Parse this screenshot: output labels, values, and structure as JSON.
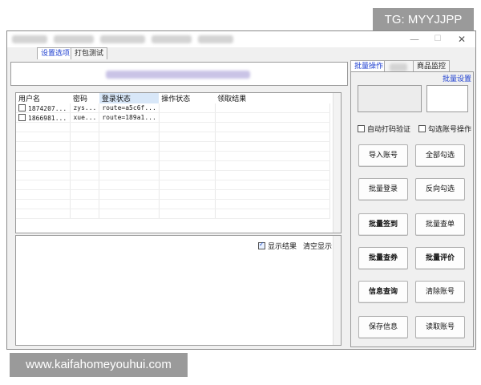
{
  "watermarks": {
    "tg": "TG: MYYJJPP",
    "url": "www.kaifahomeyouhui.com"
  },
  "window": {
    "minimize": "—",
    "maximize": "☐",
    "close": "✕"
  },
  "left_tabs": [
    "设置选项",
    "打包测试"
  ],
  "table": {
    "columns": [
      "用户名",
      "密码",
      "登录状态",
      "操作状态",
      "领取结果"
    ],
    "rows": [
      {
        "user": "1874207...",
        "pass": "zys...",
        "login": "route=a5c6f...",
        "op": "",
        "result": ""
      },
      {
        "user": "1866981...",
        "pass": "xue...",
        "login": "route=189a1...",
        "op": "",
        "result": ""
      }
    ]
  },
  "log": {
    "show_result": "显示结果",
    "clear": "清空显示"
  },
  "right_tabs": [
    "批量操作",
    "商品监控"
  ],
  "batch_settings": "批量设置",
  "options": {
    "auto_captcha": "自动打码验证",
    "check_ops": "勾选账号操作"
  },
  "buttons": [
    {
      "label": "导入账号",
      "bold": false
    },
    {
      "label": "全部勾选",
      "bold": false
    },
    {
      "label": "批量登录",
      "bold": false
    },
    {
      "label": "反向勾选",
      "bold": false
    },
    {
      "label": "批量签到",
      "bold": true
    },
    {
      "label": "批量查单",
      "bold": false
    },
    {
      "label": "批量查券",
      "bold": true
    },
    {
      "label": "批量评价",
      "bold": true
    },
    {
      "label": "信息查询",
      "bold": true
    },
    {
      "label": "清除账号",
      "bold": false
    },
    {
      "label": "保存信息",
      "bold": false
    },
    {
      "label": "读取账号",
      "bold": false
    }
  ]
}
